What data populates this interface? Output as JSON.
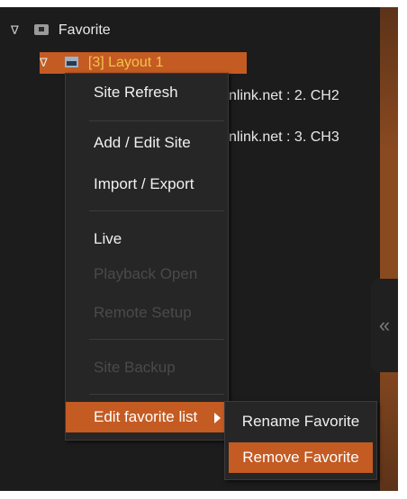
{
  "tree": {
    "favorite": {
      "expander": "∇",
      "label": "Favorite"
    },
    "layout": {
      "expander": "∇",
      "label": "[3] Layout 1"
    },
    "channels": [
      {
        "label": "nlink.net : 2. CH2"
      },
      {
        "label": "nlink.net : 3. CH3"
      }
    ]
  },
  "context_menu": {
    "items": [
      {
        "label": "Site Refresh",
        "enabled": true
      },
      {
        "label": "Add / Edit Site",
        "enabled": true
      },
      {
        "label": "Import / Export",
        "enabled": true
      },
      {
        "label": "Live",
        "enabled": true
      },
      {
        "label": "Playback Open",
        "enabled": false
      },
      {
        "label": "Remote Setup",
        "enabled": false
      },
      {
        "label": "Site Backup",
        "enabled": false
      },
      {
        "label": "Edit favorite list",
        "enabled": true,
        "highlighted": true,
        "has_submenu": true
      }
    ]
  },
  "submenu": {
    "items": [
      {
        "label": "Rename Favorite",
        "highlighted": false
      },
      {
        "label": "Remove Favorite",
        "highlighted": true
      }
    ]
  },
  "collapse_button": {
    "glyph": "«"
  },
  "colors": {
    "highlight": "#c45b23",
    "layout_text": "#f3c24d",
    "background": "#1c1c1c",
    "disabled_text": "#4a4a4a"
  }
}
